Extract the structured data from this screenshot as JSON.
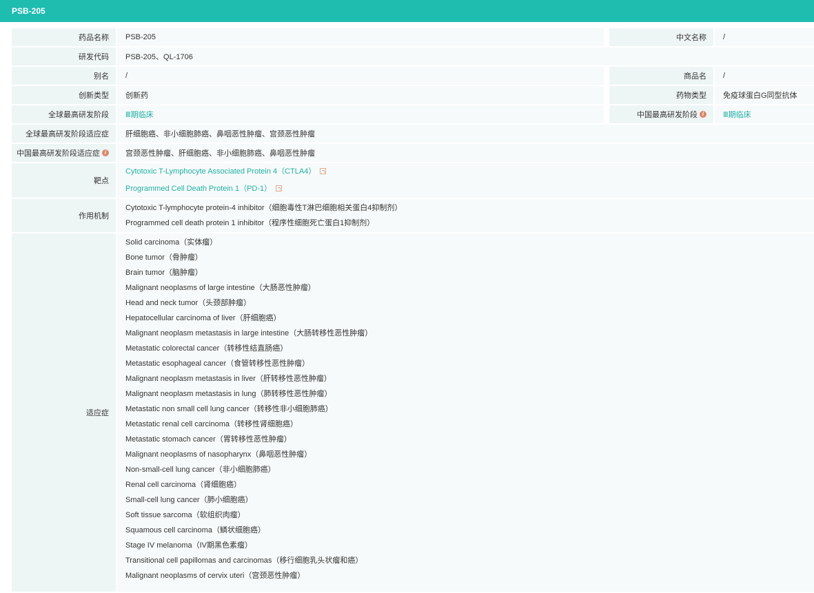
{
  "title": "PSB-205",
  "fields": {
    "drug_name": {
      "label": "药品名称",
      "value": "PSB-205"
    },
    "cn_name": {
      "label": "中文名称",
      "value": "/"
    },
    "dev_code": {
      "label": "研发代码",
      "value": "PSB-205、QL-1706"
    },
    "alias": {
      "label": "别名",
      "value": "/"
    },
    "trade_name": {
      "label": "商品名",
      "value": "/"
    },
    "innovation": {
      "label": "创新类型",
      "value": "创新药"
    },
    "drug_type": {
      "label": "药物类型",
      "value": "免疫球蛋白G同型抗体"
    },
    "global_stage": {
      "label": "全球最高研发阶段",
      "value": "Ⅲ期临床"
    },
    "china_stage": {
      "label": "中国最高研发阶段",
      "value": "Ⅲ期临床"
    },
    "global_indication": {
      "label": "全球最高研发阶段适应症",
      "value": "肝细胞癌、非小细胞肺癌、鼻咽恶性肿瘤、宫颈恶性肿瘤"
    },
    "china_indication": {
      "label": "中国最高研发阶段适应症",
      "value": "宫颈恶性肿瘤、肝细胞癌、非小细胞肺癌、鼻咽恶性肿瘤"
    },
    "targets": {
      "label": "靶点",
      "items": [
        "Cytotoxic T-Lymphocyte Associated Protein 4（CTLA4）",
        "Programmed Cell Death Protein 1（PD-1）"
      ]
    },
    "mechanism": {
      "label": "作用机制",
      "items": [
        "Cytotoxic T-lymphocyte protein-4 inhibitor（细胞毒性T淋巴细胞相关蛋白4抑制剂）",
        "Programmed cell death protein 1 inhibitor（程序性细胞死亡蛋白1抑制剂）"
      ]
    },
    "indications": {
      "label": "适应症",
      "items": [
        "Solid carcinoma（实体瘤）",
        "Bone tumor（骨肿瘤）",
        "Brain tumor（脑肿瘤）",
        "Malignant neoplasms of large intestine（大肠恶性肿瘤）",
        "Head and neck tumor（头颈部肿瘤）",
        "Hepatocellular carcinoma of liver（肝细胞癌）",
        "Malignant neoplasm metastasis in large intestine（大肠转移性恶性肿瘤）",
        "Metastatic colorectal cancer（转移性结直肠癌）",
        "Metastatic esophageal cancer（食管转移性恶性肿瘤）",
        "Malignant neoplasm metastasis in liver（肝转移性恶性肿瘤）",
        "Malignant neoplasm metastasis in lung（肺转移性恶性肿瘤）",
        "Metastatic non small cell lung cancer（转移性非小细胞肺癌）",
        "Metastatic renal cell carcinoma（转移性肾细胞癌）",
        "Metastatic stomach cancer（胃转移性恶性肿瘤）",
        "Malignant neoplasms of nasopharynx（鼻咽恶性肿瘤）",
        "Non-small-cell lung cancer（非小细胞肺癌）",
        "Renal cell carcinoma（肾细胞癌）",
        "Small-cell lung cancer（肺小细胞癌）",
        "Soft tissue sarcoma（软组织肉瘤）",
        "Squamous cell carcinoma（鳞状细胞癌）",
        "Stage IV melanoma（IV期黑色素瘤）",
        "Transitional cell papillomas and carcinomas（移行细胞乳头状瘤和癌）",
        "Malignant neoplasms of cervix uteri（宫颈恶性肿瘤）"
      ]
    }
  },
  "colors": {
    "header": "#1fbcb0",
    "link": "#1fb0a4",
    "info_icon": "#d9886a"
  }
}
